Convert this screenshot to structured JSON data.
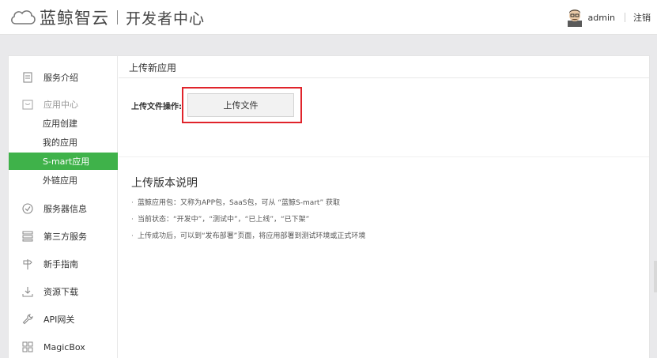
{
  "header": {
    "brand": "蓝鲸智云",
    "subtitle": "开发者中心",
    "username": "admin",
    "logout_label": "注销"
  },
  "sidebar": {
    "items": [
      {
        "label": "服务介绍",
        "icon": "scroll-icon"
      },
      {
        "label": "应用中心",
        "icon": "box-icon"
      },
      {
        "label": "服务器信息",
        "icon": "check-circle-icon"
      },
      {
        "label": "第三方服务",
        "icon": "server-stack-icon"
      },
      {
        "label": "新手指南",
        "icon": "signpost-icon"
      },
      {
        "label": "资源下载",
        "icon": "download-icon"
      },
      {
        "label": "API网关",
        "icon": "wrench-icon"
      },
      {
        "label": "MagicBox",
        "icon": "grid-icon"
      }
    ],
    "subitems": [
      {
        "label": "应用创建"
      },
      {
        "label": "我的应用"
      },
      {
        "label": "S-mart应用",
        "active": true
      },
      {
        "label": "外链应用"
      }
    ]
  },
  "content": {
    "title": "上传新应用",
    "upload_label": "上传文件操作:",
    "upload_button": "上传文件",
    "notes_title": "上传版本说明",
    "notes": [
      "蓝鲸应用包：又称为APP包，SaaS包，可从 “蓝鲸S-mart” 获取",
      "当前状态：“开发中”，“测试中”，“已上线”，“已下架”",
      "上传成功后，可以到“发布部署”页面，将应用部署到测试环境或正式环境"
    ]
  },
  "colors": {
    "accent_green": "#3fb24a",
    "highlight_red": "#e0242b"
  }
}
